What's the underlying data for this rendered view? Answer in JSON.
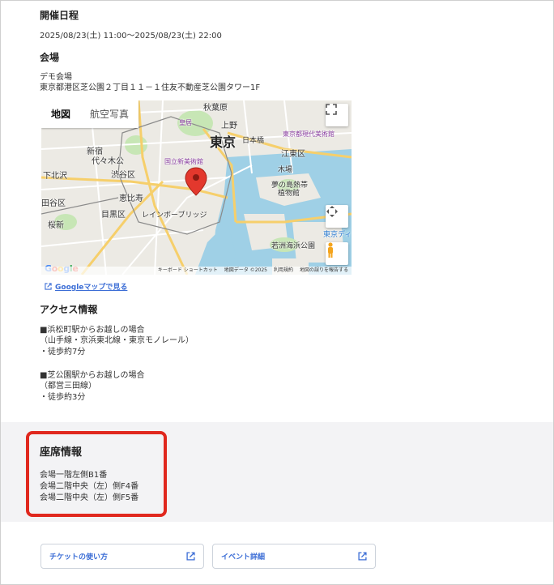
{
  "schedule": {
    "heading": "開催日程",
    "datetime": "2025/08/23(土) 11:00〜2025/08/23(土) 22:00"
  },
  "venue": {
    "heading": "会場",
    "name": "デモ会場",
    "address": "東京都港区芝公園２丁目１１－１住友不動産芝公園タワー1F"
  },
  "map": {
    "tab_map": "地図",
    "tab_satellite": "航空写真",
    "labels": {
      "tokyo": "東京",
      "koto": "江東区",
      "shibuya": "渋谷区",
      "meguro": "目黒区",
      "setagaya": "田谷区",
      "akihabara": "秋葉原",
      "ueno": "上野",
      "shinjuku": "新宿",
      "yoyogi": "代々木公",
      "kitashina": "下北沢",
      "sakurashin": "桜新",
      "ebisu": "恵比寿",
      "kokai": "皇居",
      "moma": "東京都現代美術館",
      "kokuritsu": "国立新美術館",
      "rainbow": "レインボーブリッジ",
      "wakasu": "若洲海浜公園",
      "yume": "夢の島熱帯",
      "yume2": "植物館",
      "kasai": "東京ディ",
      "kiba": "木場",
      "nihonbashi": "日本橋"
    },
    "footer": [
      "キーボード ショートカット",
      "地図データ ©2025",
      "利用規約",
      "地図の誤りを報告する"
    ],
    "google": "Google",
    "link_text": "Googleマップで見る",
    "colors": {
      "water": "#9fd0e6",
      "land": "#eceae4",
      "park": "#c7e6b5",
      "road": "#ffffff",
      "highway": "#f6cf6b",
      "pin": "#e3382d"
    }
  },
  "access": {
    "heading": "アクセス情報",
    "lines": [
      "■浜松町駅からお越しの場合",
      "（山手線・京浜東北線・東京モノレール）",
      "・徒歩約7分",
      "■芝公園駅からお越しの場合",
      "（都営三田線）",
      "・徒歩約3分"
    ]
  },
  "seats": {
    "heading": "座席情報",
    "items": [
      "会場一階左側B1番",
      "会場二階中央（左）側F4番",
      "会場二階中央（左）側F5番"
    ]
  },
  "buttons": {
    "ticket_usage": "チケットの使い方",
    "event_detail": "イベント詳細"
  },
  "colors": {
    "link": "#3c6ed6",
    "highlight_border": "#e0281e",
    "seat_background": "#f3f3f5"
  }
}
